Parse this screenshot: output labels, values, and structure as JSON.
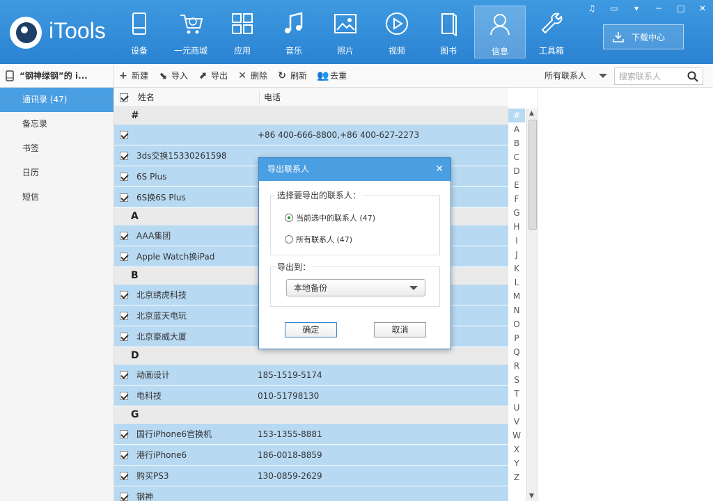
{
  "app": {
    "name": "iTools"
  },
  "nav": [
    {
      "label": "设备",
      "icon": "device-icon"
    },
    {
      "label": "一元商城",
      "icon": "cart-icon"
    },
    {
      "label": "应用",
      "icon": "apps-icon"
    },
    {
      "label": "音乐",
      "icon": "music-icon"
    },
    {
      "label": "照片",
      "icon": "photo-icon"
    },
    {
      "label": "视频",
      "icon": "video-icon"
    },
    {
      "label": "图书",
      "icon": "book-icon"
    },
    {
      "label": "信息",
      "icon": "user-icon",
      "active": true
    },
    {
      "label": "工具箱",
      "icon": "wrench-icon"
    }
  ],
  "download_label": "下载中心",
  "sidebar": {
    "device": "“钢神绿钢”的 i...",
    "items": [
      {
        "label": "通讯录 (47)",
        "active": true
      },
      {
        "label": "备忘录"
      },
      {
        "label": "书签"
      },
      {
        "label": "日历"
      },
      {
        "label": "短信"
      }
    ]
  },
  "toolbar": {
    "new": "新建",
    "import": "导入",
    "export": "导出",
    "delete": "删除",
    "refresh": "刷新",
    "dedupe": "去重",
    "filter": "所有联系人",
    "search_placeholder": "搜索联系人"
  },
  "list": {
    "col_name": "姓名",
    "col_phone": "电话",
    "groups": [
      {
        "letter": "#",
        "rows": [
          {
            "name": "",
            "phone": "+86 400-666-8800,+86 400-627-2273"
          },
          {
            "name": "3ds交换15330261598",
            "phone": ""
          },
          {
            "name": "6S Plus",
            "phone": ""
          },
          {
            "name": "6S换6S Plus",
            "phone": ""
          }
        ]
      },
      {
        "letter": "A",
        "rows": [
          {
            "name": "AAA集团",
            "phone": ""
          },
          {
            "name": "Apple Watch换iPad",
            "phone": ""
          }
        ]
      },
      {
        "letter": "B",
        "rows": [
          {
            "name": "北京绣虎科技",
            "phone": ""
          },
          {
            "name": "北京蓝天电玩",
            "phone": ""
          },
          {
            "name": "北京豪威大厦",
            "phone": ""
          }
        ]
      },
      {
        "letter": "D",
        "rows": [
          {
            "name": "动画设计",
            "phone": "185-1519-5174"
          },
          {
            "name": "电科技",
            "phone": "010-51798130"
          }
        ]
      },
      {
        "letter": "G",
        "rows": [
          {
            "name": "国行iPhone6官换机",
            "phone": "153-1355-8881"
          },
          {
            "name": "港行iPhone6",
            "phone": "186-0018-8859"
          },
          {
            "name": "购买PS3",
            "phone": "130-0859-2629"
          },
          {
            "name": "钢神",
            "phone": ""
          }
        ]
      }
    ]
  },
  "alphabet": [
    "#",
    "A",
    "B",
    "C",
    "D",
    "E",
    "F",
    "G",
    "H",
    "I",
    "J",
    "K",
    "L",
    "M",
    "N",
    "O",
    "P",
    "Q",
    "R",
    "S",
    "T",
    "U",
    "V",
    "W",
    "X",
    "Y",
    "Z"
  ],
  "dialog": {
    "title": "导出联系人",
    "select_legend": "选择要导出的联系人：",
    "option_selected": "当前选中的联系人 (47)",
    "option_all": "所有联系人 (47)",
    "export_legend": "导出到：",
    "export_target": "本地备份",
    "ok": "确定",
    "cancel": "取消"
  },
  "colors": {
    "accent": "#3f9ae0",
    "row_selected": "#b8d9f2",
    "group_bg": "#eaeaea"
  }
}
